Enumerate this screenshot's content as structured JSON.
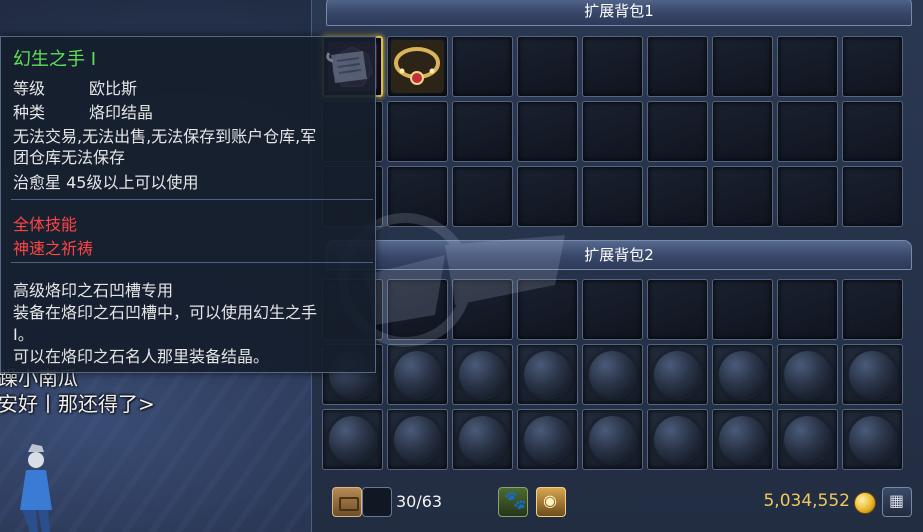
{
  "chat": {
    "line1": "躁小南瓜",
    "line2": "安好丨那还得了>"
  },
  "inventory": {
    "bag1_title": "扩展背包1",
    "bag2_title": "扩展背包2",
    "capacity": "30/63",
    "gold": "5,034,552"
  },
  "tooltip": {
    "title": "幻生之手 I",
    "level_label": "等级",
    "level_value": "欧比斯",
    "type_label": "种类",
    "type_value": "烙印结晶",
    "restriction_1": "无法交易,无法出售,无法保存到账户仓库,军",
    "restriction_2": "团仓库无法保存",
    "requirement": "治愈星 45级以上可以使用",
    "skill_category": "全体技能",
    "skill_name": "神速之祈祷",
    "desc_1": "高级烙印之石凹槽专用",
    "desc_2": "装备在烙印之石凹槽中，可以使用幻生之手",
    "desc_3": "I。",
    "desc_4": "可以在烙印之石名人那里装备结晶。"
  },
  "colors": {
    "title_green": "#5fe05a",
    "skill_red": "#ff4444",
    "gold": "#f1c85b",
    "selected_border": "#e8c84a"
  },
  "icons": {
    "item_1": "pink-rune-crystal-icon",
    "item_2": "jeweled-necklace-icon",
    "locked_slot": "locked-slot-orb-icon",
    "bag_box": "treasure-box-icon",
    "pet": "paw-icon",
    "coins": "coin-stack-icon",
    "currency": "gold-coin-icon",
    "layout_toggle": "grid-icon"
  }
}
